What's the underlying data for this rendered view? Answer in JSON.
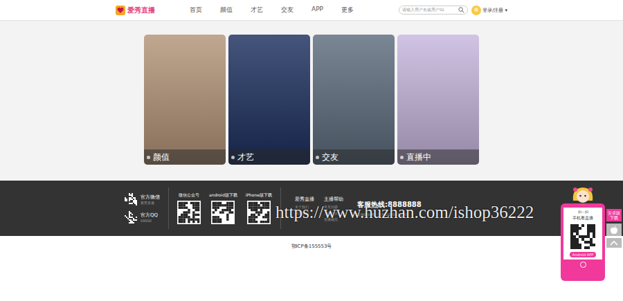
{
  "header": {
    "logo": "爱秀直播",
    "nav": [
      {
        "label": "首页",
        "selected": false
      },
      {
        "label": "颜值",
        "selected": false
      },
      {
        "label": "才艺",
        "selected": false
      },
      {
        "label": "交友",
        "selected": false
      },
      {
        "label": "APP",
        "selected": false
      },
      {
        "label": "更多",
        "selected": false
      }
    ],
    "search": {
      "placeholder": "请输入用户名或用户ID"
    },
    "login": "登录/注册",
    "caret": "▾"
  },
  "cards": [
    {
      "label": "颜值",
      "color": "#b39478"
    },
    {
      "label": "才艺",
      "color": "#1c2f5e"
    },
    {
      "label": "交友",
      "color": "#5d6c7d"
    },
    {
      "label": "直播中",
      "color": "#c7b6dd"
    }
  ],
  "footer": {
    "contacts": [
      {
        "title": "官方微信",
        "sub": "爱秀直播"
      },
      {
        "title": "官方QQ",
        "sub": "88888"
      }
    ],
    "downloads": [
      "微信公众号",
      "android版下载",
      "iPhone版下载"
    ],
    "links": [
      {
        "title": "爱秀直播",
        "items": [
          "关于我们",
          "联系我们"
        ]
      },
      {
        "title": "主播帮助",
        "items": [
          "常见问题",
          "主播协议",
          "直播规范"
        ]
      }
    ],
    "hotline": "客服热线:8888888",
    "hours": "客服时间周一至周日9:00-18:00"
  },
  "icp": "鄂ICP备155553号",
  "watermark": "https://www.huzhan.com/ishop36222",
  "float": {
    "scan": "扫一扫",
    "title": "手机看直播",
    "button": "Android APP"
  },
  "side": {
    "download": "安卓版下载"
  }
}
